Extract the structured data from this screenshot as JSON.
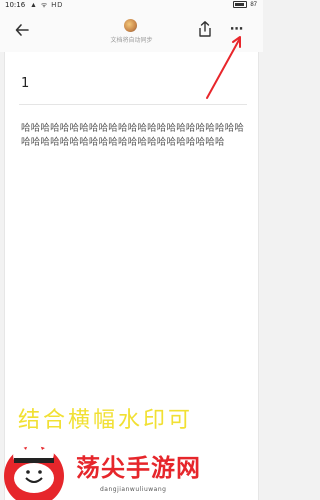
{
  "status_bar": {
    "time": "10:16",
    "left_icons": "▲ ᯤ HD",
    "battery_level": "87"
  },
  "toolbar": {
    "back_icon": "arrow-left-icon",
    "share_icon": "share-icon",
    "more_icon": "more-horizontal-icon",
    "more_label": "⋯",
    "sync_status": "文档将自动同步"
  },
  "document": {
    "title": "1",
    "body": "哈哈哈哈哈哈哈哈哈哈哈哈哈哈哈哈哈哈哈哈哈哈哈哈哈哈哈哈哈哈哈哈哈哈哈哈哈哈哈哈哈哈哈哈"
  },
  "annotation": {
    "arrow_color": "#e8262b"
  },
  "watermark": {
    "banner_text": "结合横幅水印可",
    "banner_color": "#f1e033",
    "site_name": "荡尖手游网",
    "site_name_color": "#e6262b",
    "site_url": "dangjianwuliuwang"
  }
}
